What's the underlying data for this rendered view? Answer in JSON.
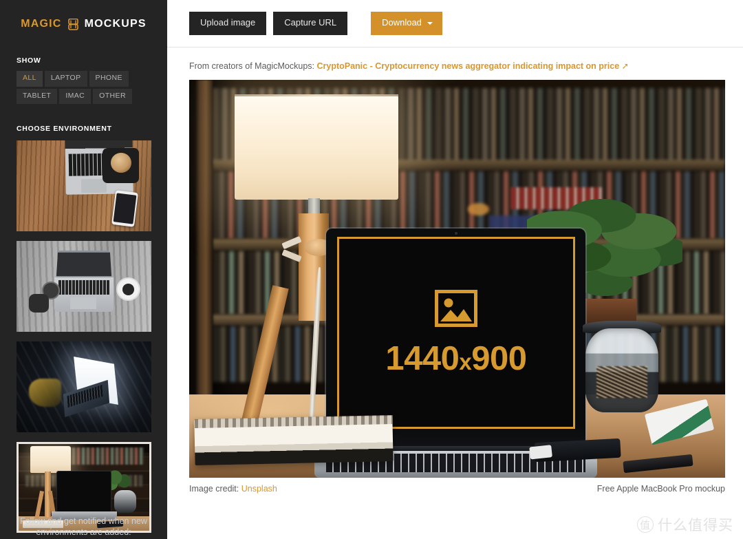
{
  "sidebar": {
    "logo": {
      "magic": "MAGIC",
      "mockups": "MOCKUPS",
      "mark": "magic-mockups-mark-icon"
    },
    "show_heading": "SHOW",
    "filters": [
      {
        "label": "ALL",
        "active": true
      },
      {
        "label": "LAPTOP",
        "active": false
      },
      {
        "label": "PHONE",
        "active": false
      },
      {
        "label": "TABLET",
        "active": false
      },
      {
        "label": "IMAC",
        "active": false
      },
      {
        "label": "OTHER",
        "active": false
      }
    ],
    "environment_heading": "CHOOSE ENVIRONMENT",
    "environments": [
      {
        "name": "wood-desk-macbook-coffee-phone",
        "selected": false
      },
      {
        "name": "bw-desk-macbook-camera-mug",
        "selected": false
      },
      {
        "name": "dark-bed-glowing-macbook",
        "selected": false
      },
      {
        "name": "lamp-bookshelf-macbook-plant",
        "selected": true
      }
    ],
    "follow_line1": "Follow and get notified when new",
    "follow_line2": "environments are added:"
  },
  "toolbar": {
    "upload_label": "Upload image",
    "capture_label": "Capture URL",
    "download_label": "Download",
    "download_caret": "chevron-down-icon"
  },
  "promo": {
    "prefix": "From creators of MagicMockups:",
    "link": "CryptoPanic - Cryptocurrency news aggregator indicating impact on price",
    "arrow": "➚"
  },
  "hero": {
    "screen_icon": "image-placeholder-icon",
    "resolution_w": "1440",
    "resolution_x": "x",
    "resolution_h": "900"
  },
  "credits": {
    "image_credit_label": "Image credit:",
    "image_credit_link": "Unsplash",
    "mockup_title": "Free Apple MacBook Pro mockup"
  },
  "watermark": {
    "mark": "值",
    "text": "什么值得买"
  },
  "colors": {
    "sidebar_bg": "#242424",
    "accent": "#d9972e",
    "download_bg": "#d49129",
    "button_bg": "#242424",
    "screen_border": "#d79a2e",
    "main_bg": "#ffffff"
  }
}
